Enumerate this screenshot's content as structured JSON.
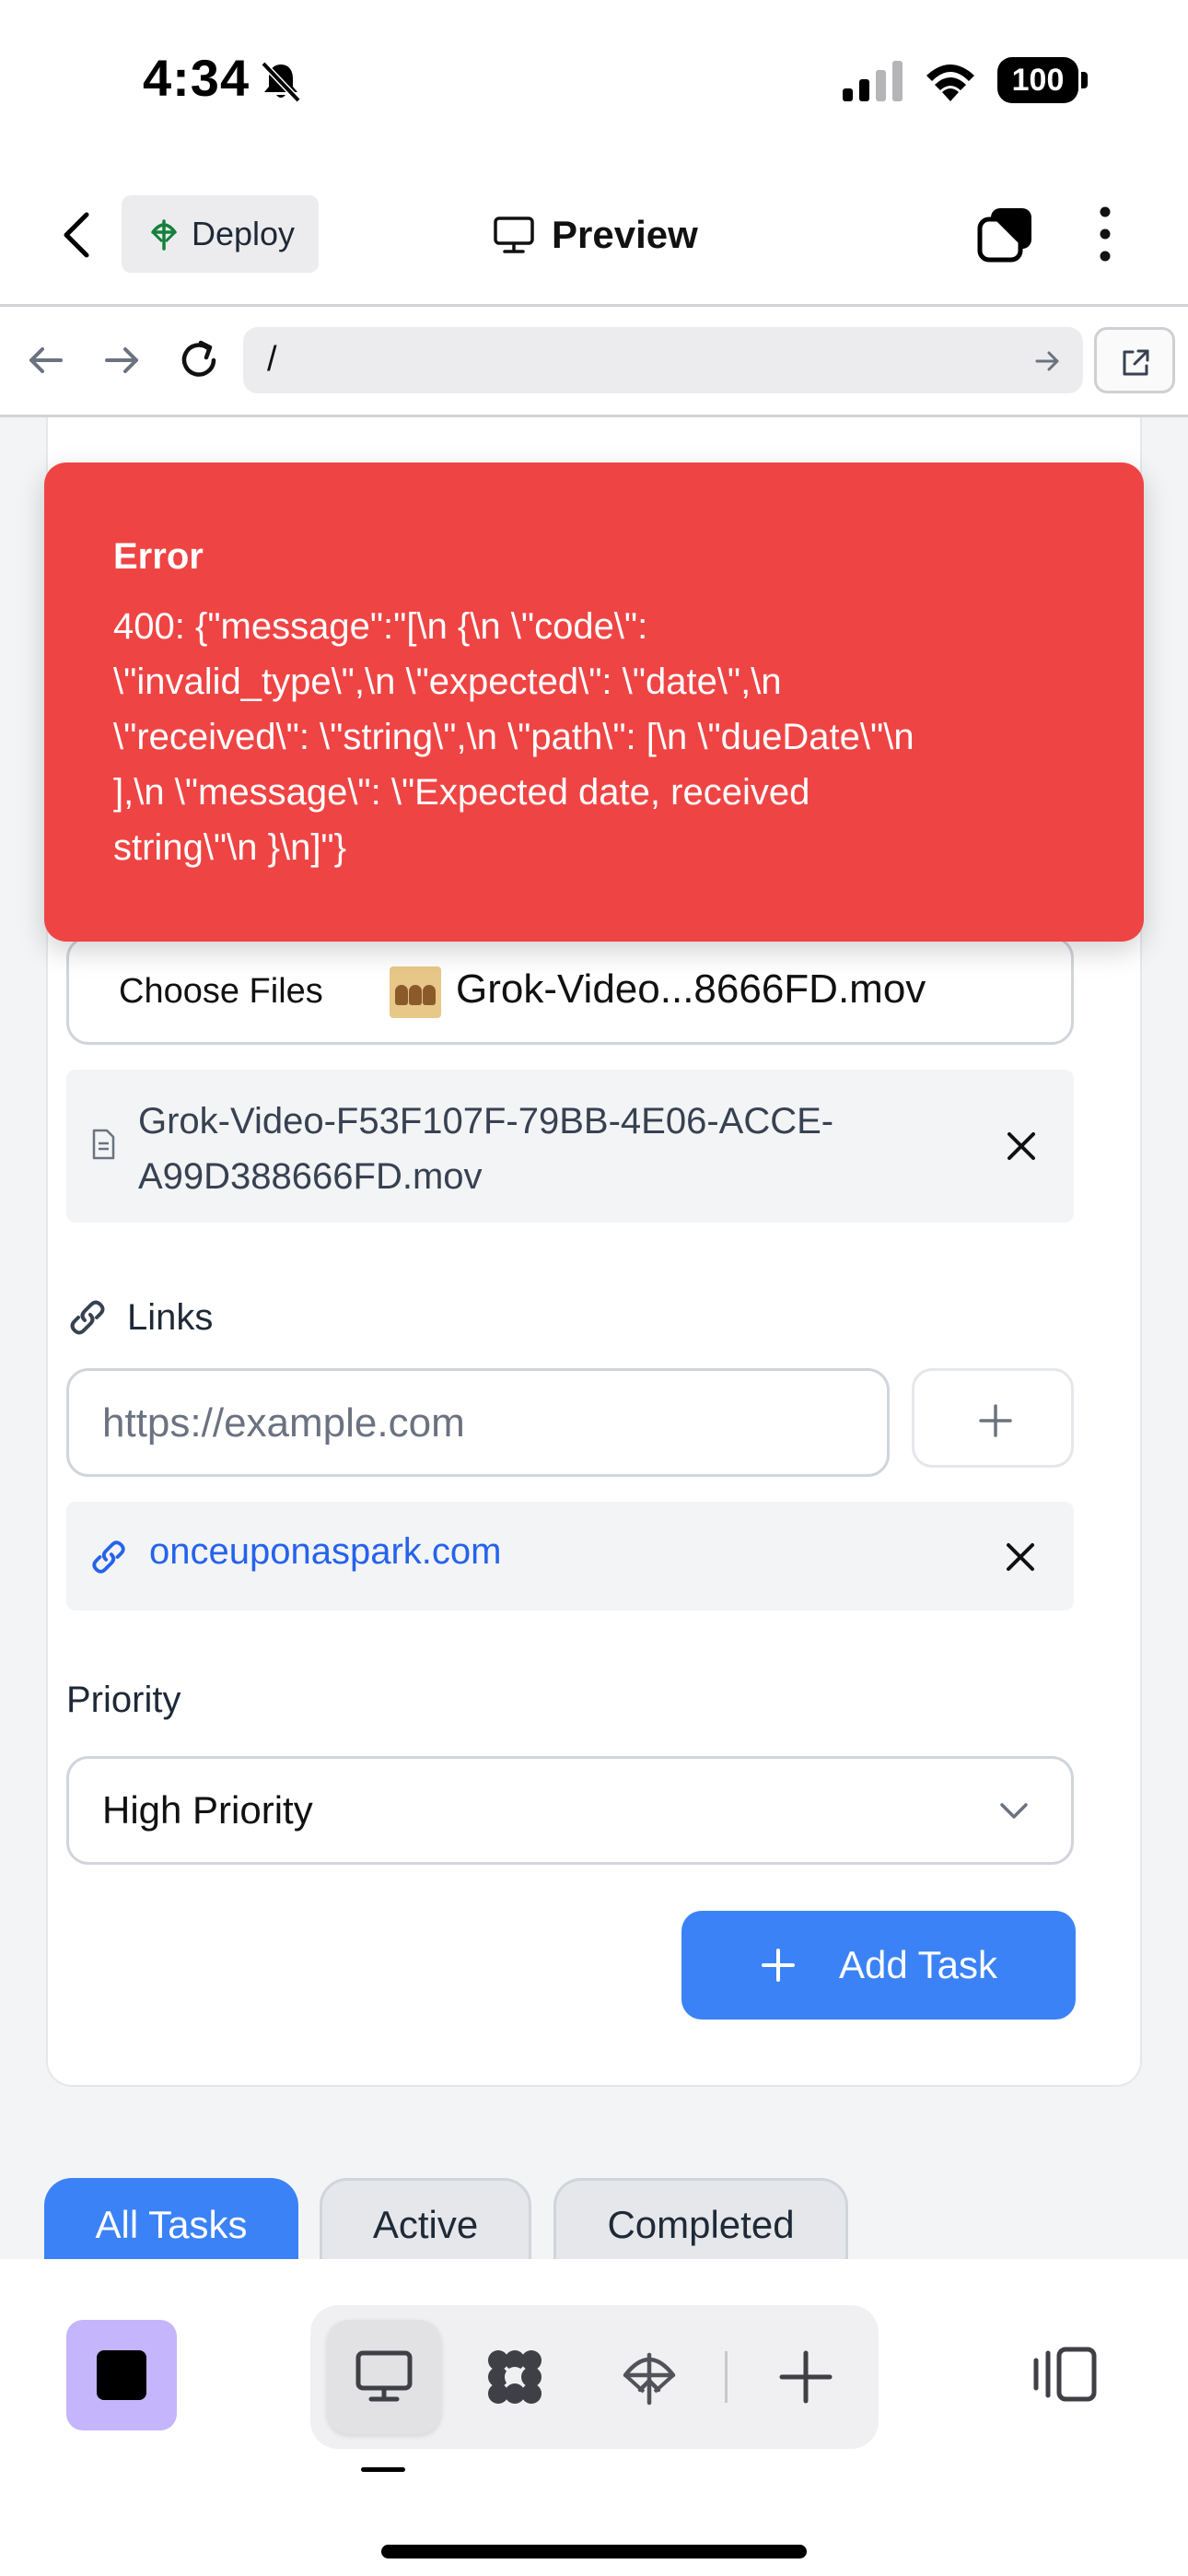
{
  "status_bar": {
    "time": "4:34",
    "battery": "100"
  },
  "top_nav": {
    "deploy_label": "Deploy",
    "title": "Preview"
  },
  "url_bar": {
    "path": "/"
  },
  "form": {
    "file_picker": {
      "button_label": "Choose Files",
      "selected_file": "Grok-Video...8666FD.mov"
    },
    "attached_files": [
      {
        "name": "Grok-Video-F53F107F-79BB-4E06-ACCE-A99D388666FD.mov"
      }
    ],
    "links": {
      "label": "Links",
      "placeholder": "https://example.com",
      "items": [
        {
          "url": "onceuponaspark.com"
        }
      ]
    },
    "priority": {
      "label": "Priority",
      "value": "High Priority"
    },
    "submit_label": "Add Task"
  },
  "filters": {
    "tabs": [
      {
        "label": "All Tasks",
        "active": true
      },
      {
        "label": "Active",
        "active": false
      },
      {
        "label": "Completed",
        "active": false
      }
    ]
  },
  "error_toast": {
    "title": "Error",
    "message": "400: {\"message\":\"[\\n {\\n \\\"code\\\":\n\\\"invalid_type\\\",\\n \\\"expected\\\": \\\"date\\\",\\n\n\\\"received\\\": \\\"string\\\",\\n \\\"path\\\": [\\n \\\"dueDate\\\"\\n\n],\\n \\\"message\\\": \\\"Expected date, received\nstring\\\"\\n }\\n]\"}"
  },
  "colors": {
    "accent": "#3b82f6",
    "error": "#ef4444",
    "stop_button": "#c4b5fd",
    "link": "#2563eb"
  },
  "icons": {
    "status": [
      "bell-slash-icon",
      "signal-icon",
      "wifi-icon",
      "battery-icon"
    ],
    "nav": [
      "back-icon",
      "deploy-icon",
      "monitor-icon",
      "tabs-icon",
      "more-icon"
    ],
    "url_bar": [
      "arrow-left-icon",
      "arrow-right-icon",
      "reload-icon",
      "go-arrow-icon",
      "external-link-icon"
    ],
    "bottom": [
      "stop-icon",
      "monitor-icon",
      "agents-icon",
      "deploy-icon",
      "plus-icon",
      "side-panel-icon"
    ]
  }
}
